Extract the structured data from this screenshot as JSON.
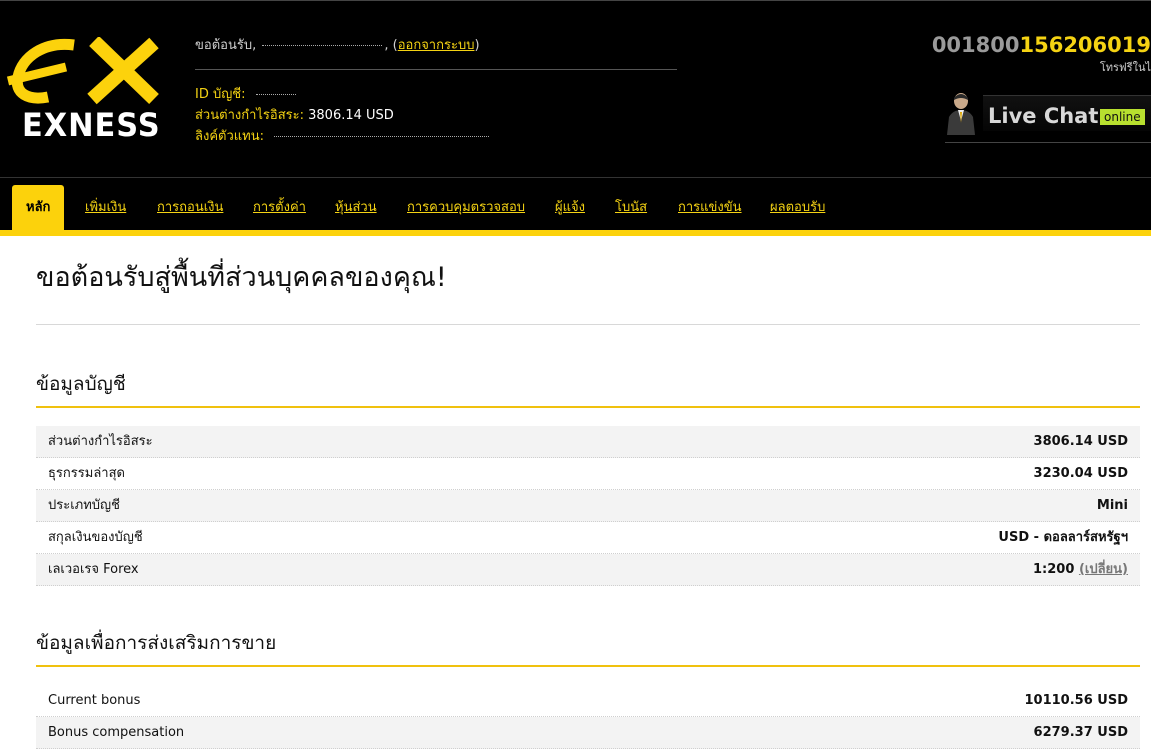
{
  "brand": {
    "name": "EXNESS",
    "colors": {
      "accent": "#fcd20c",
      "header_bg": "#000000",
      "online": "#b8e02f"
    }
  },
  "header": {
    "welcome_prefix": "ขอต้อนรับ,",
    "welcome_suffix": ",",
    "logout_label": "ออกจากระบบ",
    "account_id_label": "ID บัญชี:",
    "free_margin_label": "ส่วนต่างกำไรอิสระ:",
    "free_margin_value": "3806.14 USD",
    "agent_link_label": "ลิงค์ตัวแทน:",
    "phone_gray": "001800",
    "phone_yellow": "156206019",
    "phone_sub": "โทรฟรีในไ",
    "livechat_label": "Live Chat",
    "livechat_status": "online"
  },
  "nav": {
    "tabs": [
      {
        "label": "หลัก",
        "active": true
      },
      {
        "label": "เพิ่มเงิน"
      },
      {
        "label": "การถอนเงิน"
      },
      {
        "label": "การตั้งค่า"
      },
      {
        "label": "หุ้นส่วน"
      },
      {
        "label": "การควบคุมตรวจสอบ"
      },
      {
        "label": "ผู้แจ้ง"
      },
      {
        "label": "โบนัส"
      },
      {
        "label": "การแข่งขัน"
      },
      {
        "label": "ผลตอบรับ"
      }
    ]
  },
  "main": {
    "page_title": "ขอต้อนรับสู่พื้นที่ส่วนบุคคลของคุณ!",
    "account_section": {
      "title": "ข้อมูลบัญชี",
      "rows": [
        {
          "key": "ส่วนต่างกำไรอิสระ",
          "value": "3806.14 USD"
        },
        {
          "key": "ธุรกรรมล่าสุด",
          "value": "3230.04 USD"
        },
        {
          "key": "ประเภทบัญชี",
          "value": "Mini"
        },
        {
          "key": "สกุลเงินของบัญชี",
          "value": "USD - ดอลลาร์สหรัฐฯ"
        },
        {
          "key": "เลเวอเรจ Forex",
          "value": "1:200",
          "link": "(เปลี่ยน)"
        }
      ]
    },
    "promo_section": {
      "title": "ข้อมูลเพื่อการส่งเสริมการขาย",
      "rows": [
        {
          "key": "Current bonus",
          "value": "10110.56 USD"
        },
        {
          "key": "Bonus compensation",
          "value": "6279.37 USD"
        }
      ]
    }
  }
}
